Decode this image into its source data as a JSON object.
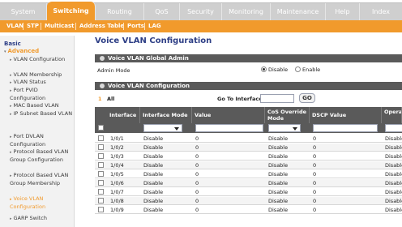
{
  "nav": {
    "tabs": [
      "System",
      "Switching",
      "Routing",
      "QoS",
      "Security",
      "Monitoring",
      "Maintenance",
      "Help",
      "Index"
    ],
    "active_tab": "Switching"
  },
  "subnav": {
    "items": [
      "VLAN",
      "STP",
      "Multicast",
      "Address Table",
      "Ports",
      "LAG"
    ]
  },
  "sidebar": {
    "basic": "Basic",
    "advanced": "Advanced",
    "items": [
      {
        "label": "VLAN Configuration"
      },
      {
        "label": "VLAN Membership"
      },
      {
        "label": "VLAN Status"
      },
      {
        "label": "Port PVID Configuration"
      },
      {
        "label": "MAC Based VLAN"
      },
      {
        "label": "IP Subnet Based VLAN"
      },
      {
        "label": "Port DVLAN Configuration"
      },
      {
        "label": "Protocol Based VLAN Group Configuration"
      },
      {
        "label": "Protocol Based VLAN Group Membership"
      },
      {
        "label": "Voice VLAN Configuration",
        "current": true
      },
      {
        "label": "GARP Switch"
      }
    ]
  },
  "main": {
    "title": "Voice VLAN Configuration",
    "global_admin": {
      "section_title": "Voice VLAN Global Admin",
      "label": "Admin Mode",
      "options": [
        "Disable",
        "Enable"
      ],
      "selected": "Disable"
    },
    "config": {
      "section_title": "Voice VLAN Configuration",
      "page_index": "1",
      "all_label": "All",
      "goto_label": "Go To Interface",
      "go_button": "GO",
      "columns": [
        "Interface",
        "Interface Mode",
        "Value",
        "CoS Override Mode",
        "DSCP Value",
        "Operational Status"
      ],
      "rows": [
        [
          "1/0/1",
          "Disable",
          "0",
          "Disable",
          "0",
          "Disable"
        ],
        [
          "1/0/2",
          "Disable",
          "0",
          "Disable",
          "0",
          "Disable"
        ],
        [
          "1/0/3",
          "Disable",
          "0",
          "Disable",
          "0",
          "Disable"
        ],
        [
          "1/0/4",
          "Disable",
          "0",
          "Disable",
          "0",
          "Disable"
        ],
        [
          "1/0/5",
          "Disable",
          "0",
          "Disable",
          "0",
          "Disable"
        ],
        [
          "1/0/6",
          "Disable",
          "0",
          "Disable",
          "0",
          "Disable"
        ],
        [
          "1/0/7",
          "Disable",
          "0",
          "Disable",
          "0",
          "Disable"
        ],
        [
          "1/0/8",
          "Disable",
          "0",
          "Disable",
          "0",
          "Disable"
        ],
        [
          "1/0/9",
          "Disable",
          "0",
          "Disable",
          "0",
          "Disable"
        ]
      ]
    }
  },
  "colors": {
    "accent": "#f19a2c",
    "title_blue": "#2e3f86",
    "header_gray": "#5a5a5a"
  }
}
